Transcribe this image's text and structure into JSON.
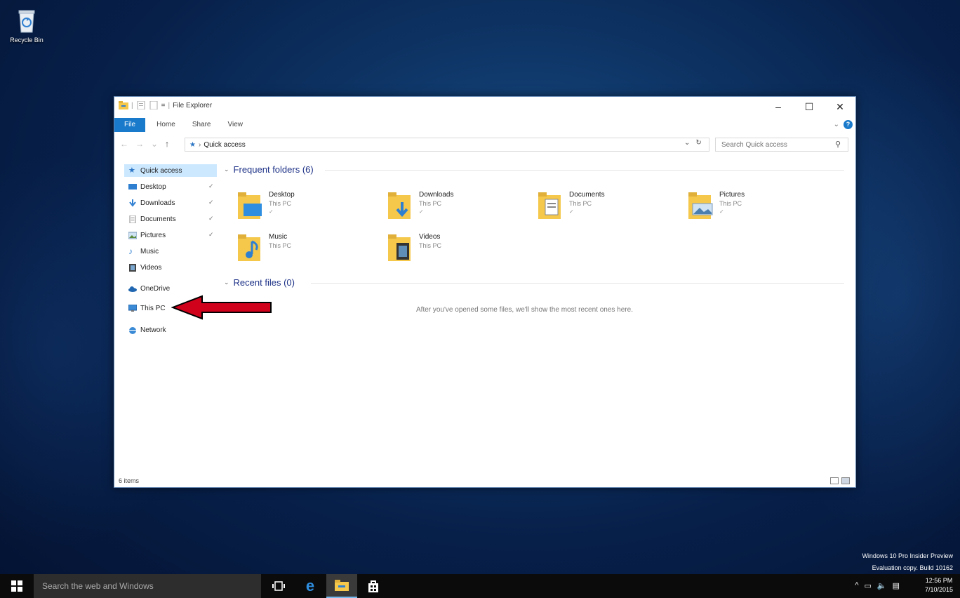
{
  "desktop": {
    "recycle_bin_label": "Recycle Bin"
  },
  "window": {
    "title": "File Explorer",
    "tabs": [
      "File",
      "Home",
      "Share",
      "View"
    ],
    "controls": {
      "minimize": "–",
      "maximize": "☐",
      "close": "✕"
    },
    "address": {
      "location": "Quick access",
      "search_placeholder": "Search Quick access"
    },
    "nav": {
      "quick_access": "Quick access",
      "desktop": "Desktop",
      "downloads": "Downloads",
      "documents": "Documents",
      "pictures": "Pictures",
      "music": "Music",
      "videos": "Videos",
      "onedrive": "OneDrive",
      "this_pc": "This PC",
      "network": "Network"
    },
    "frequent": {
      "header": "Frequent folders (6)",
      "items": [
        {
          "name": "Desktop",
          "location": "This PC"
        },
        {
          "name": "Downloads",
          "location": "This PC"
        },
        {
          "name": "Documents",
          "location": "This PC"
        },
        {
          "name": "Pictures",
          "location": "This PC"
        },
        {
          "name": "Music",
          "location": "This PC"
        },
        {
          "name": "Videos",
          "location": "This PC"
        }
      ]
    },
    "recent": {
      "header": "Recent files (0)",
      "empty_message": "After you've opened some files, we'll show the most recent ones here."
    },
    "status": "6 items"
  },
  "watermark": {
    "line1": "Windows 10 Pro Insider Preview",
    "line2": "Evaluation copy. Build 10162"
  },
  "taskbar": {
    "search_placeholder": "Search the web and Windows",
    "time": "12:56 PM",
    "date": "7/10/2015"
  },
  "colors": {
    "accent": "#1979ca",
    "arrow": "#d0021b",
    "folder": "#f5c84c"
  }
}
